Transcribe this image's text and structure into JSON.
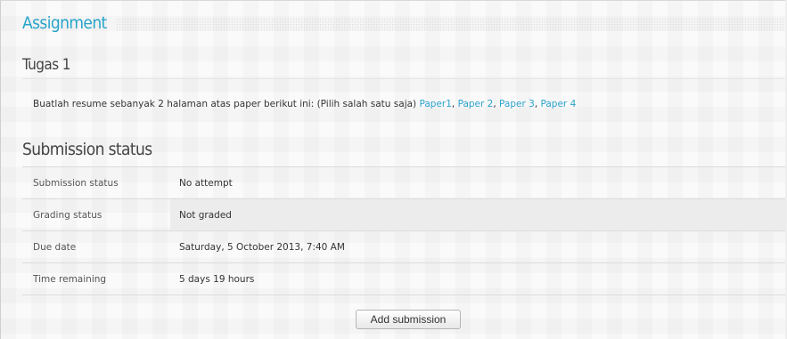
{
  "section_title": "Assignment",
  "assignment_name": "Tugas 1",
  "description": {
    "text": "Buatlah resume sebanyak 2 halaman atas paper berikut ini: (Pilih salah satu saja)",
    "links": [
      "Paper1",
      "Paper 2",
      "Paper 3",
      "Paper 4"
    ],
    "separator": ","
  },
  "submission_heading": "Submission status",
  "status_rows": [
    {
      "label": "Submission status",
      "value": "No attempt"
    },
    {
      "label": "Grading status",
      "value": "Not graded"
    },
    {
      "label": "Due date",
      "value": "Saturday, 5 October 2013, 7:40 AM"
    },
    {
      "label": "Time remaining",
      "value": "5 days 19 hours"
    }
  ],
  "add_submission_label": "Add submission",
  "colors": {
    "accent": "#27a4c9",
    "link": "#2ba3cc",
    "shaded_row": "#ececec"
  }
}
